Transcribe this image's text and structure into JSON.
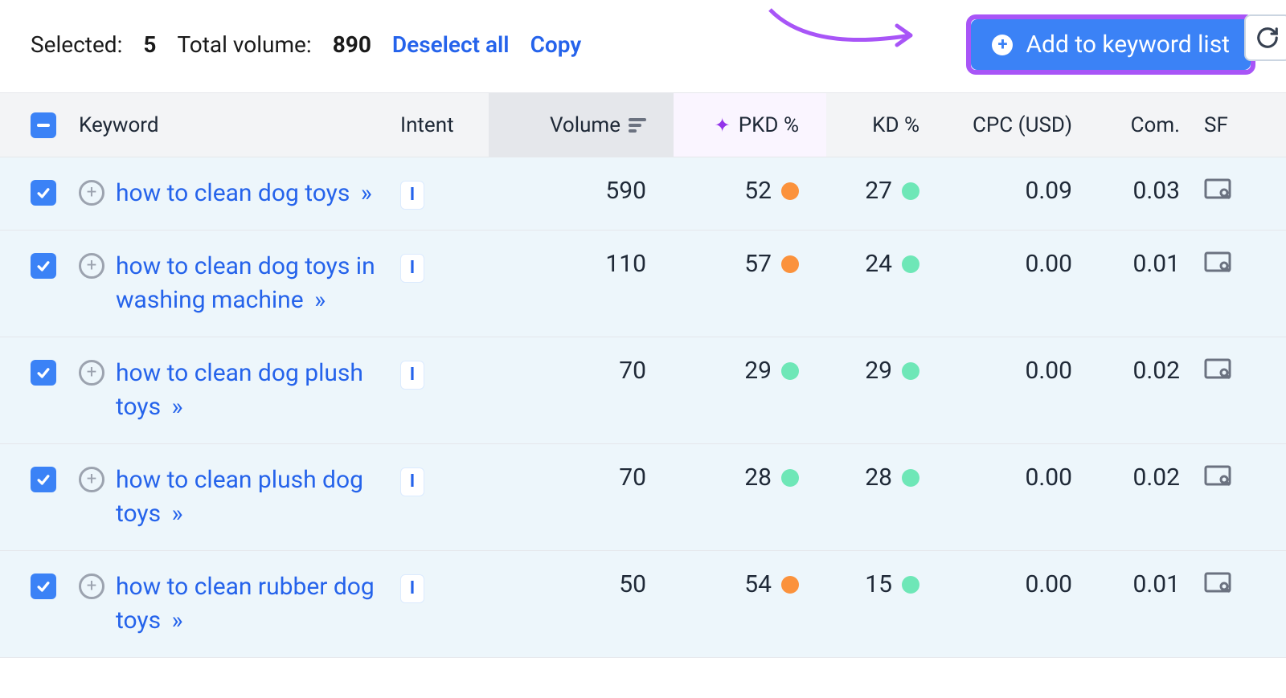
{
  "topbar": {
    "selected_label": "Selected:",
    "selected_count": "5",
    "total_volume_label": "Total volume:",
    "total_volume": "890",
    "deselect_all": "Deselect all",
    "copy": "Copy",
    "add_to_list": "Add to keyword list"
  },
  "columns": {
    "keyword": "Keyword",
    "intent": "Intent",
    "volume": "Volume",
    "pkd": "PKD %",
    "kd": "KD %",
    "cpc": "CPC (USD)",
    "com": "Com.",
    "sf": "SF"
  },
  "rows": [
    {
      "keyword": "how to clean dog toys",
      "intent": "I",
      "volume": "590",
      "pkd": "52",
      "pkd_color": "orange",
      "kd": "27",
      "kd_color": "green",
      "cpc": "0.09",
      "com": "0.03"
    },
    {
      "keyword": "how to clean dog toys in washing machine",
      "intent": "I",
      "volume": "110",
      "pkd": "57",
      "pkd_color": "orange",
      "kd": "24",
      "kd_color": "green",
      "cpc": "0.00",
      "com": "0.01"
    },
    {
      "keyword": "how to clean dog plush toys",
      "intent": "I",
      "volume": "70",
      "pkd": "29",
      "pkd_color": "green",
      "kd": "29",
      "kd_color": "green",
      "cpc": "0.00",
      "com": "0.02"
    },
    {
      "keyword": "how to clean plush dog toys",
      "intent": "I",
      "volume": "70",
      "pkd": "28",
      "pkd_color": "green",
      "kd": "28",
      "kd_color": "green",
      "cpc": "0.00",
      "com": "0.02"
    },
    {
      "keyword": "how to clean rubber dog toys",
      "intent": "I",
      "volume": "50",
      "pkd": "54",
      "pkd_color": "orange",
      "kd": "15",
      "kd_color": "green",
      "cpc": "0.00",
      "com": "0.01"
    }
  ]
}
